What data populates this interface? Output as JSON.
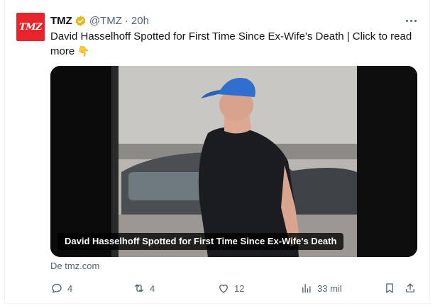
{
  "post": {
    "avatar_text": "TMZ",
    "display_name": "TMZ",
    "handle": "@TMZ",
    "separator": "·",
    "time": "20h",
    "text": "David Hasselhoff Spotted for First Time Since Ex-Wife's Death  |  Click to read more",
    "emoji": "👇",
    "media_caption": "David Hasselhoff Spotted for First Time Since Ex-Wife's Death",
    "source": "De tmz.com"
  },
  "actions": {
    "replies": "4",
    "reposts": "4",
    "likes": "12",
    "views": "33 mil"
  },
  "colors": {
    "avatar_bg": "#e8232b",
    "verified_gold": "#e2b719",
    "muted_text": "#536471"
  },
  "icons": [
    "verified-badge-icon",
    "more-icon",
    "reply-icon",
    "repost-icon",
    "like-icon",
    "views-icon",
    "bookmark-icon",
    "share-icon"
  ]
}
